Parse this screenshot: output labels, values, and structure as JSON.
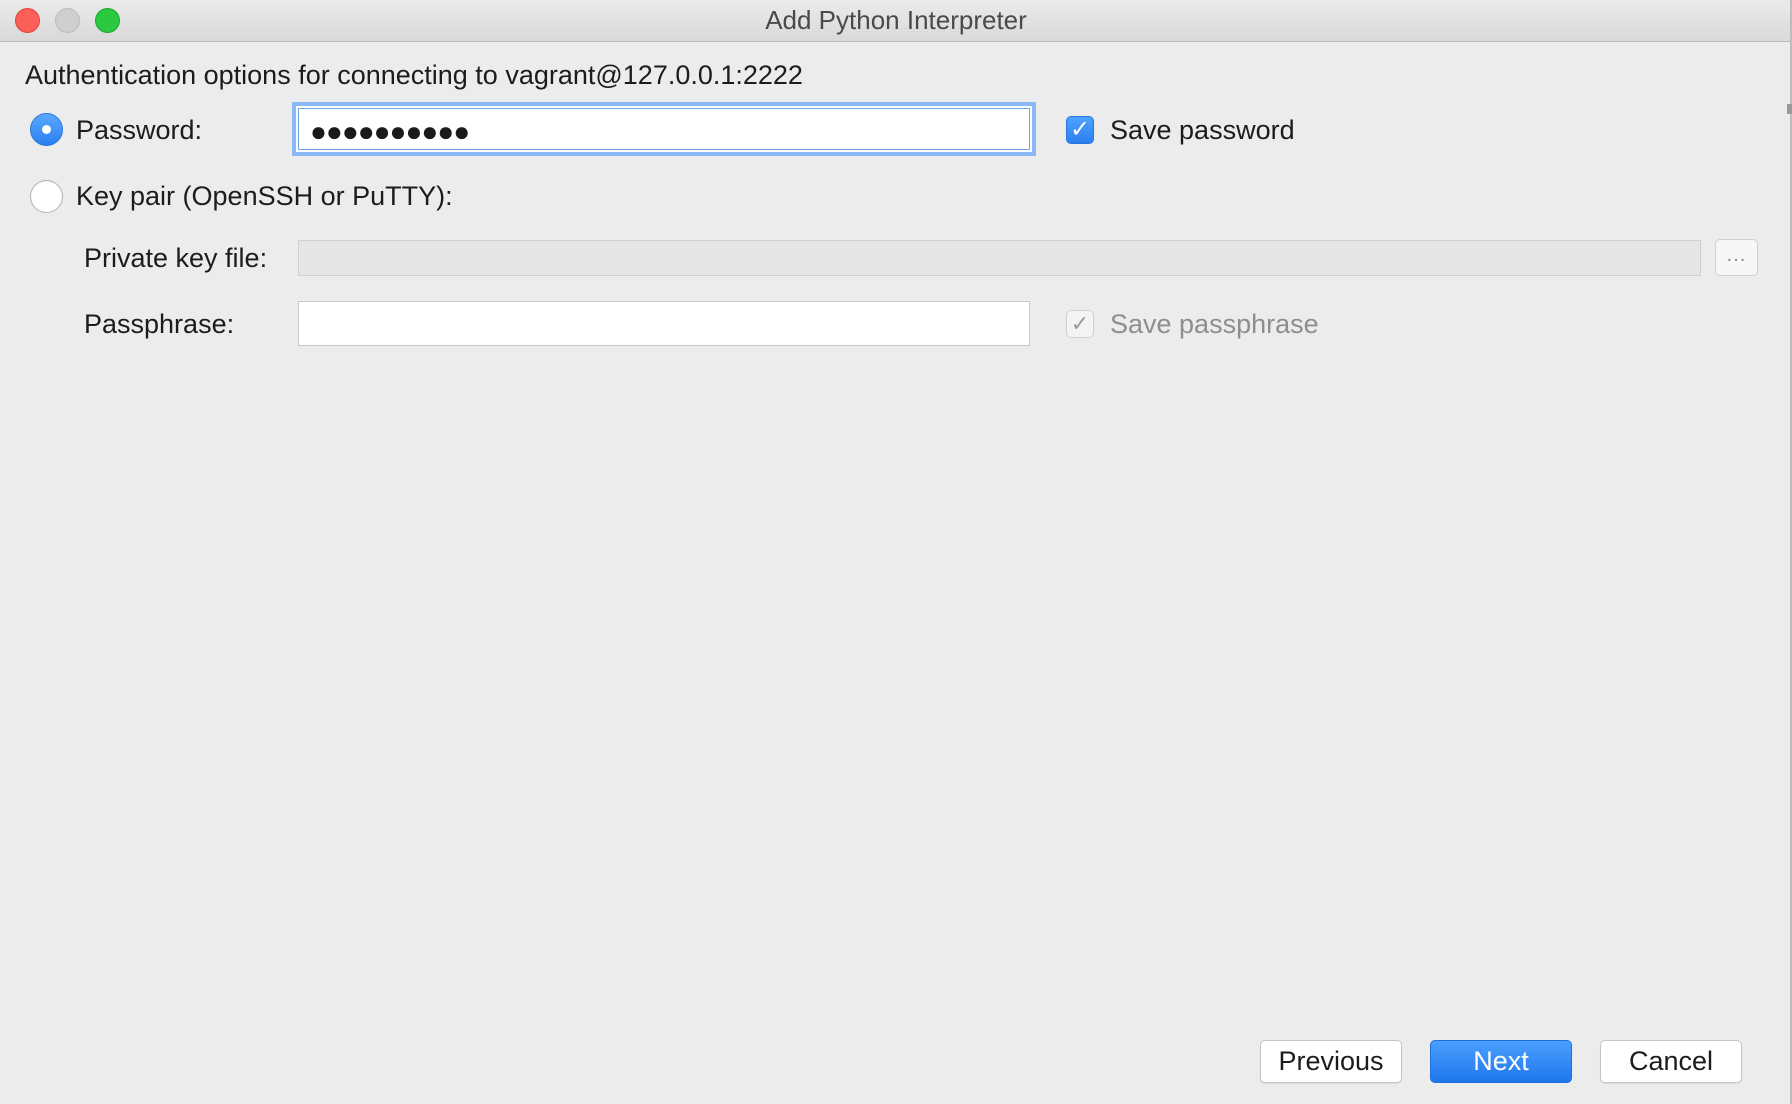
{
  "window": {
    "title": "Add Python Interpreter"
  },
  "auth": {
    "header": "Authentication options for connecting to vagrant@127.0.0.1:2222",
    "selected_method": "password",
    "password": {
      "label": "Password:",
      "masked_value": "●●●●●●●●●●",
      "save_label": "Save password",
      "save_checked": true
    },
    "key_pair": {
      "label": "Key pair (OpenSSH or PuTTY):",
      "private_key_label": "Private key file:",
      "private_key_value": "",
      "browse_label": "...",
      "passphrase_label": "Passphrase:",
      "passphrase_value": "",
      "save_passphrase_label": "Save passphrase",
      "save_passphrase_checked": true
    }
  },
  "buttons": {
    "previous": "Previous",
    "next": "Next",
    "cancel": "Cancel"
  },
  "colors": {
    "accent": "#2a7ff0",
    "window_bg": "#ececec",
    "close": "#fc5f57",
    "minimize": "#cfcfcf",
    "zoom": "#2ac940"
  }
}
